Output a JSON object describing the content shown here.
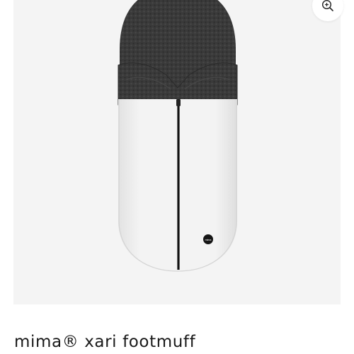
{
  "product": {
    "title": "mima® xari footmuff",
    "image_alt": "mima® xari footmuff",
    "badge_text": "mima"
  },
  "gallery": {
    "zoom_icon": "zoom-in-icon"
  },
  "colors": {
    "gallery_background": "#f4f4f4",
    "footmuff_body": "#f2f2f2",
    "footmuff_lining": "#3a3a3a",
    "zipper": "#111111",
    "title_text": "#1a1a1a"
  }
}
